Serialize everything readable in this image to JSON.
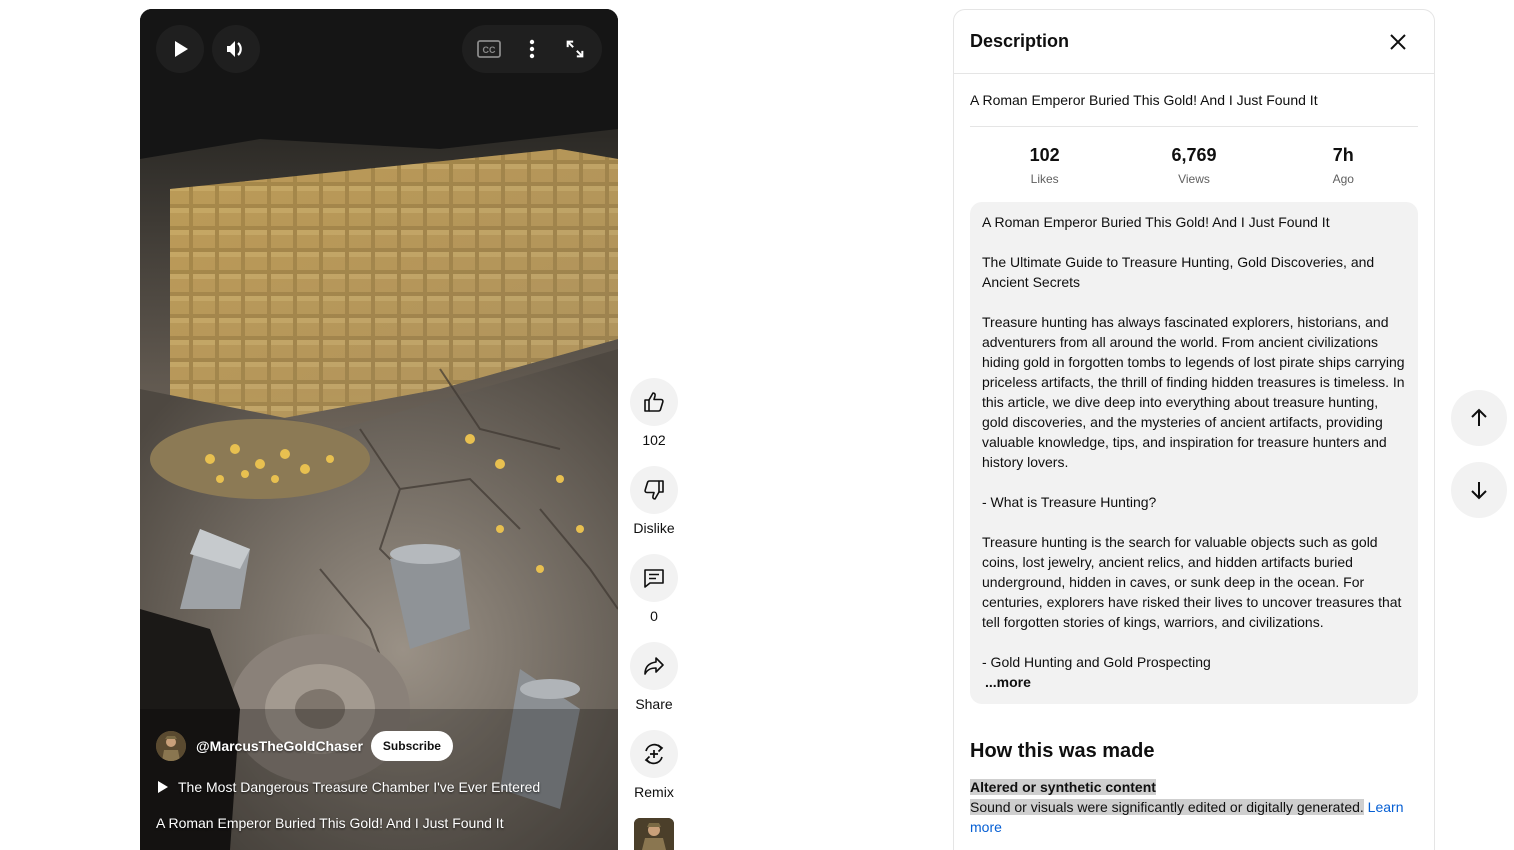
{
  "player": {
    "controls": {
      "play_icon": "play-icon",
      "volume_icon": "volume-icon",
      "captions_icon": "closed-captions-icon",
      "more_icon": "more-vert-icon",
      "fullscreen_icon": "fullscreen-icon"
    },
    "channel_handle": "@MarcusTheGoldChaser",
    "subscribe_label": "Subscribe",
    "playlist_title": "The Most Dangerous Treasure Chamber I've Ever Entered",
    "video_title": "A Roman Emperor Buried This Gold! And I Just Found It"
  },
  "actions": [
    {
      "icon": "thumb-up-icon",
      "label": "102"
    },
    {
      "icon": "thumb-down-icon",
      "label": "Dislike"
    },
    {
      "icon": "comment-icon",
      "label": "0"
    },
    {
      "icon": "share-icon",
      "label": "Share"
    },
    {
      "icon": "remix-icon",
      "label": "Remix"
    }
  ],
  "description_panel": {
    "title": "Description",
    "headline": "A Roman Emperor Buried This Gold! And I Just Found It",
    "stats": [
      {
        "value": "102",
        "label": "Likes"
      },
      {
        "value": "6,769",
        "label": "Views"
      },
      {
        "value": "7h",
        "label": "Ago"
      }
    ],
    "description_paragraphs": [
      "A Roman Emperor Buried This Gold! And I Just Found It",
      "The Ultimate Guide to Treasure Hunting, Gold Discoveries, and Ancient Secrets",
      "Treasure hunting has always fascinated explorers, historians, and adventurers from all around the world. From ancient civilizations hiding gold in forgotten tombs to legends of lost pirate ships carrying priceless artifacts, the thrill of finding hidden treasures is timeless. In this article, we dive deep into everything about treasure hunting, gold discoveries, and the mysteries of ancient artifacts, providing valuable knowledge, tips, and inspiration for treasure hunters and history lovers.",
      "- What is Treasure Hunting?",
      "Treasure hunting is the search for valuable objects such as gold coins, lost jewelry, ancient relics, and hidden artifacts buried underground, hidden in caves, or sunk deep in the ocean. For centuries, explorers have risked their lives to uncover treasures that tell forgotten stories of kings, warriors, and civilizations.",
      "- Gold Hunting and Gold Prospecting"
    ],
    "more_label": "...more",
    "how_made_title": "How this was made",
    "synthetic_title": "Altered or synthetic content",
    "synthetic_text": "Sound or visuals were significantly edited or digitally generated.",
    "learn_more_label": "Learn more"
  },
  "nav": {
    "up_icon": "arrow-up-icon",
    "down_icon": "arrow-down-icon"
  },
  "colors": {
    "link": "#065fd4",
    "panel_bg": "#f2f2f2"
  }
}
